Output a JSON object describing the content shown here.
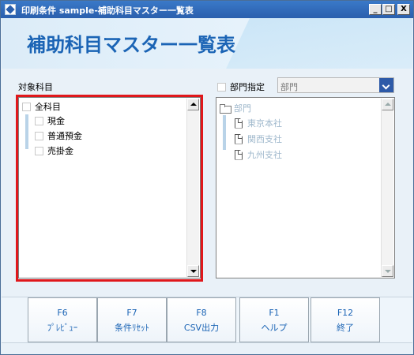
{
  "window": {
    "title": "印刷条件 sample-補助科目マスター一覧表",
    "controls": [
      "_",
      "□",
      "X"
    ]
  },
  "header": {
    "title": "補助科目マスター一覧表"
  },
  "left_panel": {
    "label": "対象科目",
    "root": "全科目",
    "items": [
      "現金",
      "普通預金",
      "売掛金"
    ]
  },
  "right_panel": {
    "checkbox_label": "部門指定",
    "dropdown_value": "部門",
    "root": "部門",
    "items": [
      "東京本社",
      "関西支社",
      "九州支社"
    ]
  },
  "function_keys": [
    {
      "key": "F6",
      "label": "ﾌﾟﾚﾋﾞｭｰ"
    },
    {
      "key": "F7",
      "label": "条件ﾘｾｯﾄ"
    },
    {
      "key": "F8",
      "label": "CSV出力"
    },
    {
      "key": "F1",
      "label": "ヘルプ"
    },
    {
      "key": "F12",
      "label": "終了"
    }
  ],
  "colors": {
    "accent": "#1b64b5",
    "highlight": "#e0171b",
    "titlebar": "#2a5fad"
  }
}
